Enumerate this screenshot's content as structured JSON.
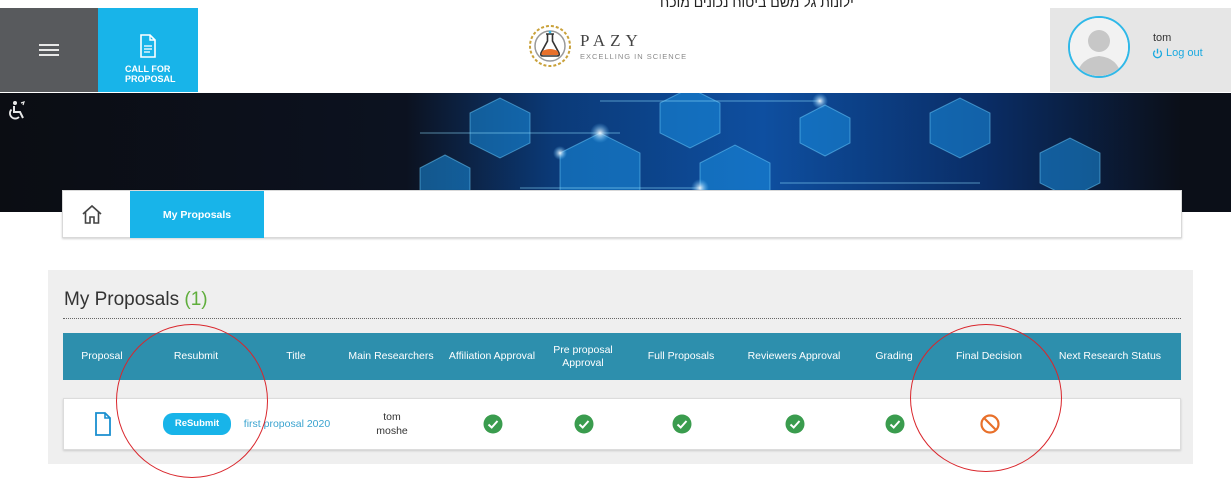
{
  "top_caption": "ילונות גל משם ביטוח נכונים מוכח",
  "header": {
    "menu_icon": "hamburger-icon",
    "call_for_proposal_label": "CALL FOR PROPOSAL",
    "call_for_proposal_icon": "document-icon",
    "logo": {
      "name": "PAZY",
      "tagline": "EXCELLING IN SCIENCE"
    },
    "user": {
      "name": "tom",
      "logout_label": "Log out",
      "avatar_icon": "user-avatar-icon",
      "logout_icon": "power-icon"
    }
  },
  "accessibility_icon": "accessibility-icon",
  "breadcrumb": {
    "home_icon": "home-icon",
    "active_tab": "My Proposals"
  },
  "proposals": {
    "heading": "My Proposals",
    "count": "(1)",
    "columns": [
      "Proposal",
      "Resubmit",
      "Title",
      "Main Researchers",
      "Affiliation Approval",
      "Pre proposal Approval",
      "Full Proposals",
      "Reviewers Approval",
      "Grading",
      "Final Decision",
      "Next Research Status"
    ],
    "rows": [
      {
        "proposal_icon": "file-icon",
        "resubmit_label": "ReSubmit",
        "title": "first proposal 2020",
        "researchers": [
          "tom",
          "moshe"
        ],
        "affiliation_approval": "check-icon",
        "pre_proposal_approval": "check-icon",
        "full_proposals": "check-icon",
        "reviewers_approval": "check-icon",
        "grading": "check-icon",
        "final_decision": "prohibited-icon",
        "next_research_status": ""
      }
    ]
  },
  "colors": {
    "accent": "#18b4e9",
    "table_header": "#2d8fad",
    "success": "#3a9c4e",
    "rejected": "#e8702a",
    "count": "#5fae3c",
    "annotation": "#d9262c"
  }
}
